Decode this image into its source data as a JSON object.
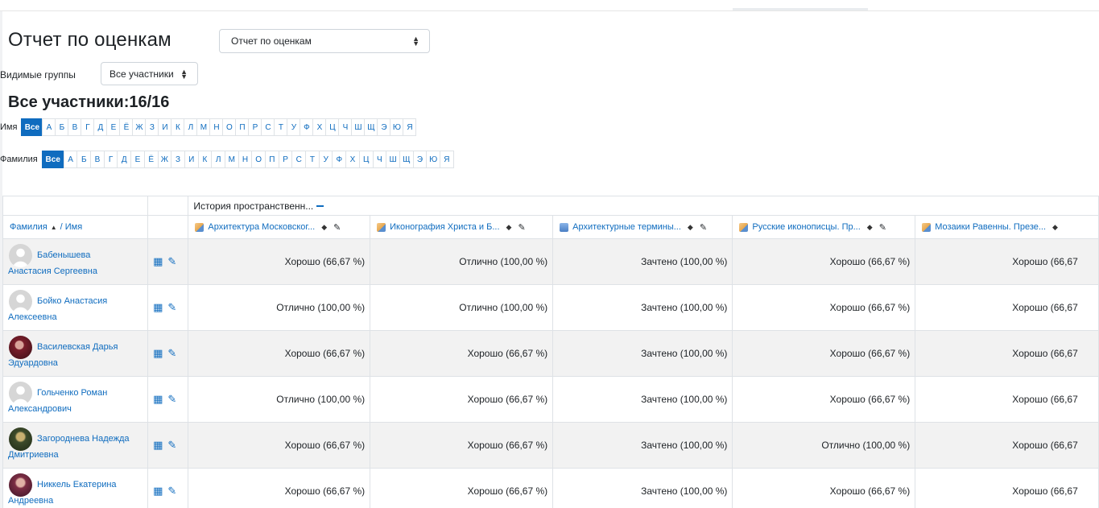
{
  "report": {
    "title": "Отчет по оценкам",
    "selector_value": "Отчет по оценкам"
  },
  "groups": {
    "label": "Видимые группы",
    "selected": "Все участники"
  },
  "participants_summary": "Все участники:16/16",
  "first_name_filter": {
    "label": "Имя",
    "letters": [
      "Все",
      "А",
      "Б",
      "В",
      "Г",
      "Д",
      "Е",
      "Ё",
      "Ж",
      "З",
      "И",
      "К",
      "Л",
      "М",
      "Н",
      "О",
      "П",
      "Р",
      "С",
      "Т",
      "У",
      "Ф",
      "Х",
      "Ц",
      "Ч",
      "Ш",
      "Щ",
      "Э",
      "Ю",
      "Я"
    ],
    "active": "Все"
  },
  "surname_filter": {
    "label": "Фамилия",
    "letters": [
      "Все",
      "А",
      "Б",
      "В",
      "Г",
      "Д",
      "Е",
      "Ё",
      "Ж",
      "З",
      "И",
      "К",
      "Л",
      "М",
      "Н",
      "О",
      "П",
      "Р",
      "С",
      "Т",
      "У",
      "Ф",
      "Х",
      "Ц",
      "Ч",
      "Ш",
      "Щ",
      "Э",
      "Ю",
      "Я"
    ],
    "active": "Все"
  },
  "table": {
    "category": "История пространственн...",
    "name_header": {
      "surname": "Фамилия",
      "slash": "/",
      "first_name": "Имя"
    },
    "items": [
      {
        "name": "Архитектура Московског...",
        "icon": "page-icon"
      },
      {
        "name": "Иконография Христа и Б...",
        "icon": "page-icon"
      },
      {
        "name": "Архитектурные термины...",
        "icon": "quiz-icon"
      },
      {
        "name": "Русские иконописцы. Пр...",
        "icon": "page-icon"
      },
      {
        "name": "Мозаики Равенны. Презе...",
        "icon": "page-icon"
      }
    ],
    "rows": [
      {
        "name_line1": "Бабенышева",
        "name_line2": "Анастасия Сергеевна",
        "avatar": "blank",
        "grades": [
          "Хорошо (66,67 %)",
          "Отлично (100,00 %)",
          "Зачтено (100,00 %)",
          "Хорошо (66,67 %)",
          "Хорошо (66,67"
        ]
      },
      {
        "name_line1": "Бойко Анастасия",
        "name_line2": "Алексеевна",
        "avatar": "blank",
        "grades": [
          "Отлично (100,00 %)",
          "Отлично (100,00 %)",
          "Зачтено (100,00 %)",
          "Хорошо (66,67 %)",
          "Хорошо (66,67"
        ]
      },
      {
        "name_line1": "Василевская Дарья",
        "name_line2": "Эдуардовна",
        "avatar": "ph1",
        "grades": [
          "Хорошо (66,67 %)",
          "Хорошо (66,67 %)",
          "Зачтено (100,00 %)",
          "Хорошо (66,67 %)",
          "Хорошо (66,67"
        ]
      },
      {
        "name_line1": "Гольченко Роман",
        "name_line2": "Александрович",
        "avatar": "blank",
        "grades": [
          "Отлично (100,00 %)",
          "Хорошо (66,67 %)",
          "Зачтено (100,00 %)",
          "Хорошо (66,67 %)",
          "Хорошо (66,67"
        ]
      },
      {
        "name_line1": "Загороднева Надежда",
        "name_line2": "Дмитриевна",
        "avatar": "ph2",
        "grades": [
          "Хорошо (66,67 %)",
          "Хорошо (66,67 %)",
          "Зачтено (100,00 %)",
          "Отлично (100,00 %)",
          "Хорошо (66,67"
        ]
      },
      {
        "name_line1": "Никкель Екатерина",
        "name_line2": "Андреевна",
        "avatar": "ph3",
        "grades": [
          "Хорошо (66,67 %)",
          "Хорошо (66,67 %)",
          "Зачтено (100,00 %)",
          "Хорошо (66,67 %)",
          "Хорошо (66,67"
        ]
      }
    ]
  },
  "colors": {
    "link": "#0f6cbf",
    "row_stripe": "#f2f2f2",
    "border": "#dee2e6"
  }
}
